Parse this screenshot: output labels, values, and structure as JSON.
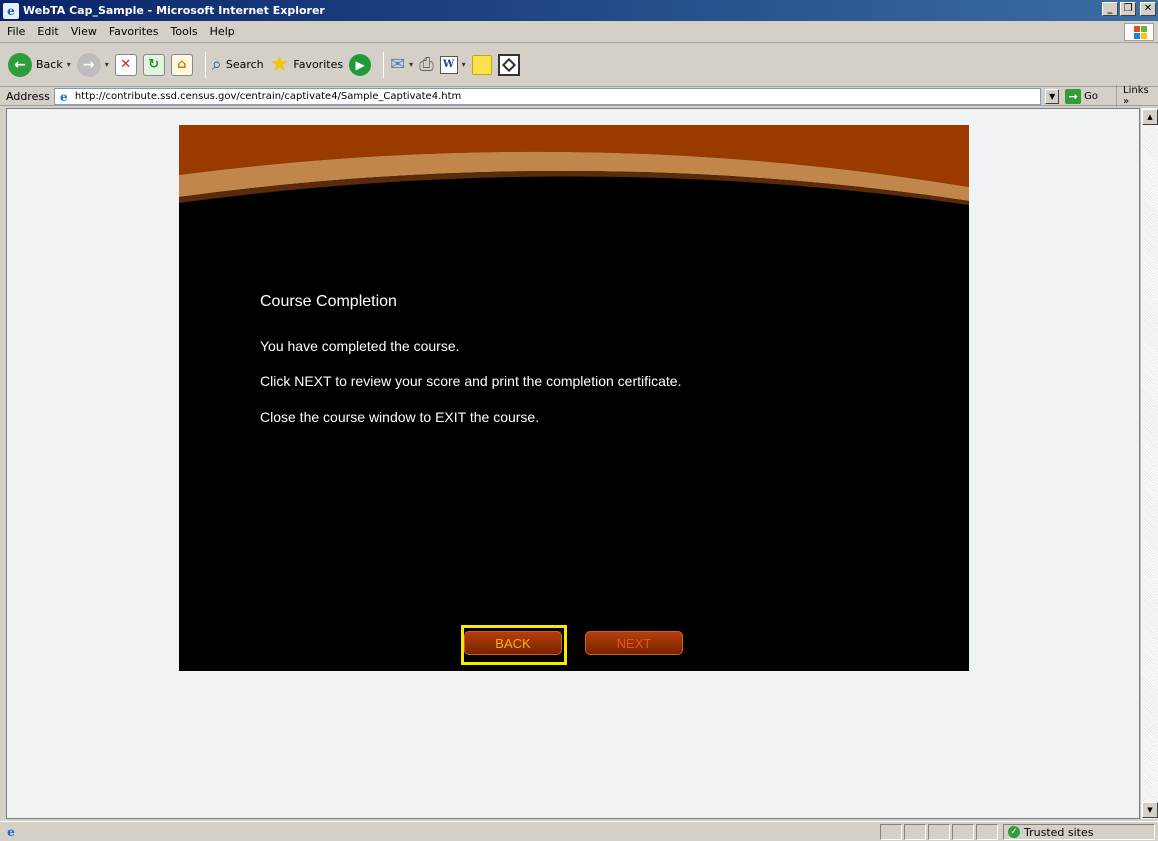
{
  "window": {
    "title": "WebTA Cap_Sample - Microsoft Internet Explorer",
    "minimize": "_",
    "maximize": "×",
    "close": "×"
  },
  "menu": {
    "file": "File",
    "edit": "Edit",
    "view": "View",
    "favorites": "Favorites",
    "tools": "Tools",
    "help": "Help"
  },
  "toolbar": {
    "back_label": "Back",
    "search_label": "Search",
    "favorites_label": "Favorites"
  },
  "address": {
    "label": "Address",
    "url": "http://contribute.ssd.census.gov/centrain/captivate4/Sample_Captivate4.htm",
    "go_label": "Go",
    "links_label": "Links »"
  },
  "slide": {
    "title": "Course Completion",
    "line1": "You have completed the course.",
    "line2": "Click NEXT to review your score and print the completion certificate.",
    "line3": "Close the course window to EXIT the course.",
    "back_button": "BACK",
    "next_button": "NEXT"
  },
  "status": {
    "zone": "Trusted sites"
  },
  "colors": {
    "movie_header": "#9a3a00",
    "arc_band": "#c0864a",
    "focus_outline": "#f6ec00",
    "button_text": "#ffb300"
  }
}
